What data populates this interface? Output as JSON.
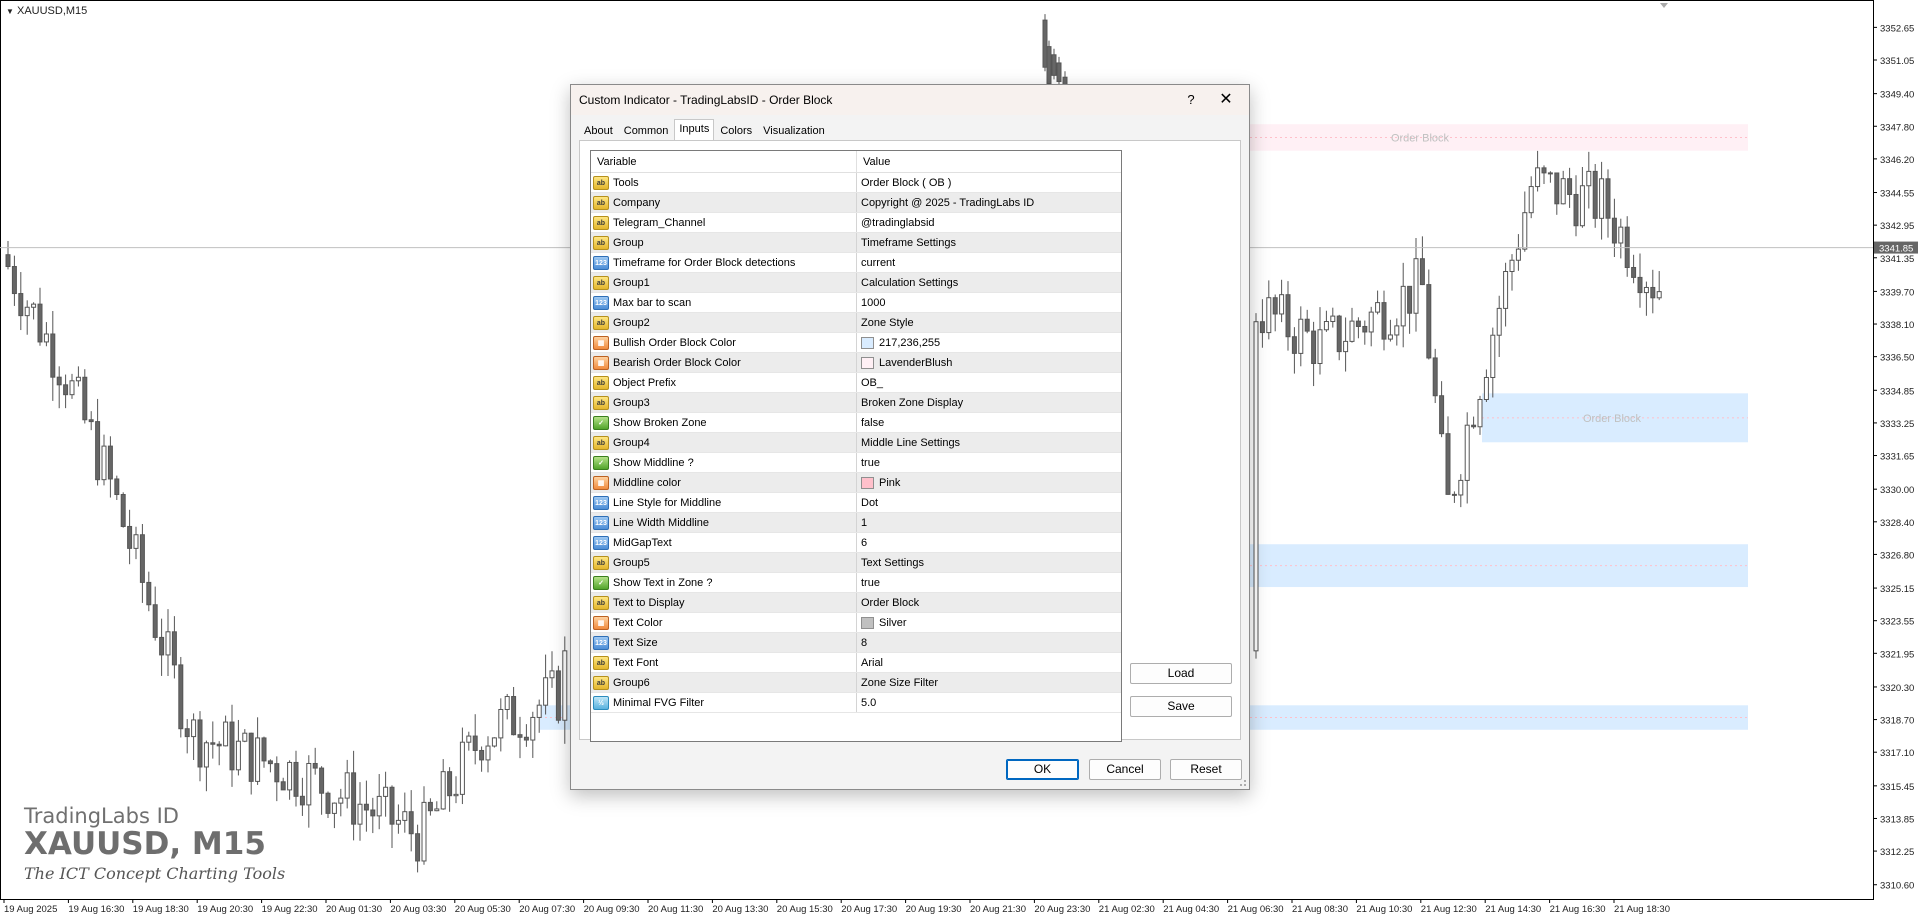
{
  "chart": {
    "symbol_label": "XAUUSD,M15",
    "current_price": "3341.85",
    "price_axis": [
      "3352.65",
      "3351.05",
      "3349.40",
      "3347.80",
      "3346.20",
      "3344.55",
      "3342.95",
      "3341.35",
      "3339.70",
      "3338.10",
      "3336.50",
      "3334.85",
      "3333.25",
      "3331.65",
      "3330.00",
      "3328.40",
      "3326.80",
      "3325.15",
      "3323.55",
      "3321.95",
      "3320.30",
      "3318.70",
      "3317.10",
      "3315.45",
      "3313.85",
      "3312.25",
      "3310.60"
    ],
    "time_axis": [
      "19 Aug 2025",
      "19 Aug 16:30",
      "19 Aug 18:30",
      "19 Aug 20:30",
      "19 Aug 22:30",
      "20 Aug 01:30",
      "20 Aug 03:30",
      "20 Aug 05:30",
      "20 Aug 07:30",
      "20 Aug 09:30",
      "20 Aug 11:30",
      "20 Aug 13:30",
      "20 Aug 15:30",
      "20 Aug 17:30",
      "20 Aug 19:30",
      "20 Aug 21:30",
      "20 Aug 23:30",
      "21 Aug 02:30",
      "21 Aug 04:30",
      "21 Aug 06:30",
      "21 Aug 08:30",
      "21 Aug 10:30",
      "21 Aug 12:30",
      "21 Aug 14:30",
      "21 Aug 16:30",
      "21 Aug 18:30"
    ],
    "zone_label": "Order Block",
    "zones": [
      {
        "bottom": 3346.6,
        "top": 3347.9,
        "color": "#fff0f5"
      },
      {
        "bottom": 3332.3,
        "top": 3334.7,
        "color": "#d9ecff"
      },
      {
        "bottom": 3325.2,
        "top": 3327.3,
        "color": "#d9ecff"
      },
      {
        "bottom": 3318.2,
        "top": 3319.4,
        "color": "#d9ecff"
      }
    ],
    "watermark": {
      "brand": "TradingLabs ID",
      "symbol": "XAUUSD, M15",
      "tagline": "The ICT Concept Charting Tools"
    }
  },
  "dialog": {
    "title": "Custom Indicator - TradingLabsID - Order Block",
    "help_label": "?",
    "close_label": "✕",
    "tabs": [
      "About",
      "Common",
      "Inputs",
      "Colors",
      "Visualization"
    ],
    "active_tab": "Inputs",
    "columns": {
      "variable": "Variable",
      "value": "Value"
    },
    "rows": [
      {
        "type": "ab",
        "variable": "Tools",
        "value": "Order Block ( OB )"
      },
      {
        "type": "ab",
        "variable": "Company",
        "value": "Copyright @ 2025 - TradingLabs ID"
      },
      {
        "type": "ab",
        "variable": "Telegram_Channel",
        "value": "@tradinglabsid"
      },
      {
        "type": "ab",
        "variable": "Group",
        "value": "Timeframe Settings"
      },
      {
        "type": "num",
        "variable": "Timeframe for Order Block detections",
        "value": "current"
      },
      {
        "type": "ab",
        "variable": "Group1",
        "value": "Calculation Settings"
      },
      {
        "type": "num",
        "variable": "Max bar to scan",
        "value": "1000"
      },
      {
        "type": "ab",
        "variable": "Group2",
        "value": "Zone Style"
      },
      {
        "type": "col",
        "variable": "Bullish Order Block Color",
        "value": "217,236,255",
        "swatch": "#d9ecff"
      },
      {
        "type": "col",
        "variable": "Bearish Order Block Color",
        "value": "LavenderBlush",
        "swatch": "#fff0f5"
      },
      {
        "type": "ab",
        "variable": "Object Prefix",
        "value": "OB_"
      },
      {
        "type": "ab",
        "variable": "Group3",
        "value": "Broken Zone Display"
      },
      {
        "type": "bool",
        "variable": "Show Broken Zone",
        "value": "false"
      },
      {
        "type": "ab",
        "variable": "Group4",
        "value": "Middle Line Settings"
      },
      {
        "type": "bool",
        "variable": "Show Middline ?",
        "value": "true"
      },
      {
        "type": "col",
        "variable": "Middline color",
        "value": "Pink",
        "swatch": "#ffc0cb"
      },
      {
        "type": "num",
        "variable": "Line Style for Middline",
        "value": "Dot"
      },
      {
        "type": "num",
        "variable": "Line Width Middline",
        "value": "1"
      },
      {
        "type": "num",
        "variable": "MidGapText",
        "value": "6"
      },
      {
        "type": "ab",
        "variable": "Group5",
        "value": "Text Settings"
      },
      {
        "type": "bool",
        "variable": "Show Text in Zone ?",
        "value": "true"
      },
      {
        "type": "ab",
        "variable": "Text to Display",
        "value": "Order Block"
      },
      {
        "type": "col",
        "variable": "Text Color",
        "value": "Silver",
        "swatch": "#c0c0c0"
      },
      {
        "type": "num",
        "variable": "Text Size",
        "value": "8"
      },
      {
        "type": "ab",
        "variable": "Text Font",
        "value": "Arial"
      },
      {
        "type": "ab",
        "variable": "Group6",
        "value": "Zone Size Filter"
      },
      {
        "type": "dbl",
        "variable": "Minimal FVG Filter",
        "value": "5.0"
      }
    ],
    "buttons": {
      "load": "Load",
      "save": "Save",
      "ok": "OK",
      "cancel": "Cancel",
      "reset": "Reset"
    }
  }
}
